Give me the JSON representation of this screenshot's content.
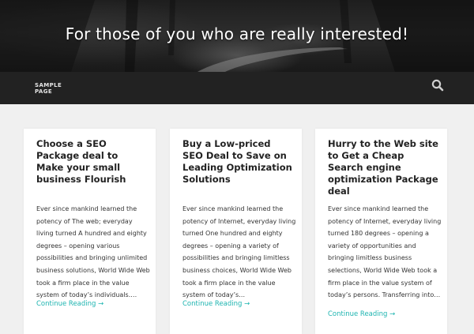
{
  "hero": {
    "title": "For those of you who are really interested!"
  },
  "nav": {
    "items": [
      {
        "label": "SAMPLE PAGE"
      }
    ],
    "search_icon": "search-icon"
  },
  "colors": {
    "accent": "#1db4b0",
    "navbar": "#222222",
    "background": "#f0f0f0"
  },
  "posts": [
    {
      "title": "Choose a SEO Package deal to Make your small business Flourish",
      "excerpt": "Ever since mankind learned the potency of The web; everyday living turned A hundred and eighty degrees – opening various possibilities and bringing unlimited business solutions, World Wide Web took a firm place in the value system of today’s individuals.…",
      "more": "Continue Reading →"
    },
    {
      "title": "Buy a Low-priced SEO Deal to Save on Leading Optimization Solutions",
      "excerpt": "Ever since mankind learned the potency of Internet, everyday living turned One hundred and eighty degrees – opening a variety of possibilities and bringing limitless business choices, World Wide Web took a firm place in the value system of today’s…",
      "more": "Continue Reading →"
    },
    {
      "title": "Hurry to the Web site to Get a Cheap Search engine optimization Package deal",
      "excerpt": "Ever since mankind learned the potency of Internet, everyday living turned 180 degrees – opening a variety of opportunities and bringing limitless business selections, World Wide Web took a firm place in the value system of today’s persons. Transferring into…",
      "more": "Continue Reading →"
    }
  ]
}
